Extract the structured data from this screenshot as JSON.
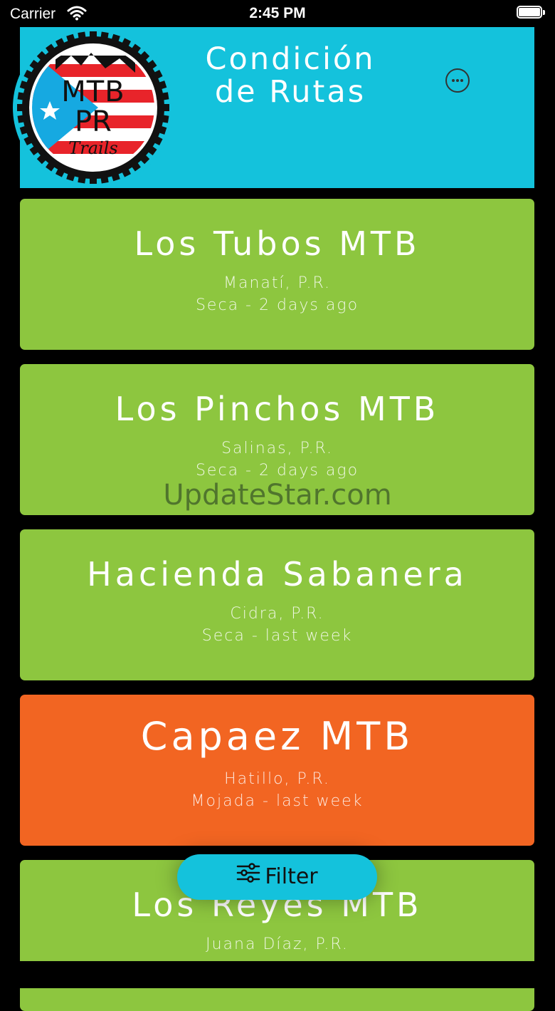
{
  "status_bar": {
    "carrier": "Carrier",
    "time": "2:45 PM"
  },
  "header": {
    "title": "Condición\nde Rutas",
    "background_color": "#14c2dc",
    "logo_text": {
      "line1": "MTB",
      "line2": "PR",
      "line3": "Trails"
    }
  },
  "trails": [
    {
      "name": "Los Tubos MTB",
      "location": "Manatí, P.R.",
      "status": "Seca - 2 days ago",
      "color": "#8dc63f"
    },
    {
      "name": "Los Pinchos MTB",
      "location": "Salinas, P.R.",
      "status": "Seca - 2 days ago",
      "color": "#8dc63f"
    },
    {
      "name": "Hacienda Sabanera",
      "location": "Cidra, P.R.",
      "status": "Seca - last week",
      "color": "#8dc63f"
    },
    {
      "name": "Capaez MTB",
      "location": "Hatillo, P.R.",
      "status": "Mojada - last week",
      "color": "#f26522"
    },
    {
      "name": "Los Reyes MTB",
      "location": "Juana Díaz, P.R.",
      "status": "",
      "color": "#8dc63f"
    }
  ],
  "filter": {
    "label": "Filter"
  },
  "watermark": "UpdateStar.com"
}
